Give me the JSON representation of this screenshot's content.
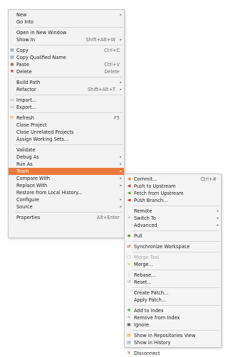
{
  "main_menu": {
    "items": [
      {
        "label": "New",
        "submenu": true
      },
      {
        "label": "Go Into"
      },
      {
        "sep": true
      },
      {
        "label": "Open in New Window"
      },
      {
        "label": "Show In",
        "shortcut": "Shift+Alt+W",
        "submenu": true
      },
      {
        "sep": true
      },
      {
        "label": "Copy",
        "shortcut": "Ctrl+C",
        "icon": "copy-icon",
        "glyph": "▤",
        "color": "#6a7d94"
      },
      {
        "label": "Copy Qualified Name",
        "icon": "copy-qualified-name-icon",
        "glyph": "▤",
        "color": "#6a7d94"
      },
      {
        "label": "Paste",
        "shortcut": "Ctrl+V",
        "icon": "paste-icon",
        "glyph": "▣",
        "color": "#8a6a3a"
      },
      {
        "label": "Delete",
        "shortcut": "Delete",
        "icon": "delete-icon",
        "glyph": "✖",
        "color": "#d0312d"
      },
      {
        "sep": true
      },
      {
        "label": "Build Path",
        "submenu": true
      },
      {
        "label": "Refactor",
        "shortcut": "Shift+Alt+T",
        "submenu": true
      },
      {
        "sep": true
      },
      {
        "label": "Import...",
        "icon": "import-icon",
        "glyph": "▭",
        "color": "#5b7fb0"
      },
      {
        "label": "Export...",
        "icon": "export-icon",
        "glyph": "▭",
        "color": "#5b7fb0"
      },
      {
        "sep": true
      },
      {
        "label": "Refresh",
        "shortcut": "F5",
        "icon": "refresh-icon",
        "glyph": "⟳",
        "color": "#d99a1e"
      },
      {
        "label": "Close Project"
      },
      {
        "label": "Close Unrelated Projects"
      },
      {
        "label": "Assign Working Sets..."
      },
      {
        "sep": true
      },
      {
        "label": "Validate"
      },
      {
        "label": "Debug As",
        "submenu": true
      },
      {
        "label": "Run As",
        "submenu": true
      },
      {
        "label": "Team",
        "submenu": true,
        "highlight": true
      },
      {
        "label": "Compare With",
        "submenu": true
      },
      {
        "label": "Replace With",
        "submenu": true
      },
      {
        "label": "Restore from Local History..."
      },
      {
        "label": "Configure",
        "submenu": true
      },
      {
        "label": "Source",
        "submenu": true
      },
      {
        "sep": true
      },
      {
        "label": "Properties",
        "shortcut": "Alt+Enter"
      }
    ]
  },
  "team_submenu": {
    "items": [
      {
        "label": "Commit...",
        "shortcut": "Ctrl+#",
        "icon": "commit-icon",
        "glyph": "◀",
        "color": "#d9831f"
      },
      {
        "label": "Push to Upstream",
        "icon": "push-to-upstream-icon",
        "glyph": "◀",
        "color": "#c0392b"
      },
      {
        "label": "Fetch from Upstream",
        "icon": "fetch-from-upstream-icon",
        "glyph": "◀",
        "color": "#5aa02c"
      },
      {
        "label": "Push Branch...",
        "icon": "push-branch-icon",
        "glyph": "◀",
        "color": "#c0392b"
      },
      {
        "sep": true
      },
      {
        "label": "Remote",
        "submenu": true
      },
      {
        "label": "Switch To",
        "submenu": true,
        "icon": "switch-to-icon",
        "glyph": "⑂",
        "color": "#5a7fa8"
      },
      {
        "label": "Advanced",
        "submenu": true
      },
      {
        "sep": true
      },
      {
        "label": "Pull",
        "icon": "pull-icon",
        "glyph": "◆",
        "color": "#5aa02c"
      },
      {
        "sep": true
      },
      {
        "label": "Synchronize Workspace",
        "icon": "synchronize-workspace-icon",
        "glyph": "⇄",
        "color": "#c0392b"
      },
      {
        "sep": true
      },
      {
        "label": "Merge Tool",
        "disabled": true,
        "icon": "merge-tool-icon",
        "glyph": "▢",
        "color": "#b0b0b0"
      },
      {
        "label": "Merge...",
        "icon": "merge-icon",
        "glyph": "⋎",
        "color": "#d9a21f"
      },
      {
        "sep": true
      },
      {
        "label": "Rebase...",
        "icon": "rebase-icon",
        "glyph": "⋮",
        "color": "#5aa02c"
      },
      {
        "label": "Reset...",
        "icon": "reset-icon",
        "glyph": "↺",
        "color": "#7a8fa8"
      },
      {
        "sep": true
      },
      {
        "label": "Create Patch..."
      },
      {
        "label": "Apply Patch..."
      },
      {
        "sep": true
      },
      {
        "label": "Add to Index",
        "icon": "add-to-index-icon",
        "glyph": "✚",
        "color": "#3a9a3a"
      },
      {
        "label": "Remove from Index",
        "icon": "remove-from-index-icon",
        "glyph": "━",
        "color": "#7a8fa8"
      },
      {
        "label": "Ignore",
        "icon": "ignore-icon",
        "glyph": "▣",
        "color": "#555555"
      },
      {
        "sep": true
      },
      {
        "label": "Show in Repositories View",
        "icon": "show-in-repositories-view-icon",
        "glyph": "▤",
        "color": "#d9a21f"
      },
      {
        "label": "Show in History",
        "icon": "show-in-history-icon",
        "glyph": "▤",
        "color": "#7a8fa8"
      },
      {
        "sep": true
      },
      {
        "label": "Disconnect",
        "icon": "disconnect-icon",
        "glyph": "↯",
        "color": "#c0392b"
      }
    ]
  }
}
